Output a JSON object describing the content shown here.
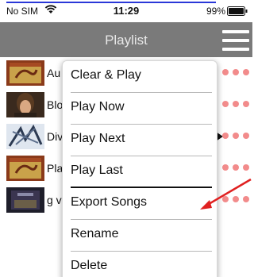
{
  "status_bar": {
    "carrier": "No SIM",
    "time": "11:29",
    "battery": "99%"
  },
  "nav": {
    "title": "Playlist"
  },
  "playlist": {
    "rows": [
      {
        "title": "Au"
      },
      {
        "title": "Blo"
      },
      {
        "title": "Div"
      },
      {
        "title": "Pla"
      },
      {
        "title": "g v"
      }
    ]
  },
  "menu": {
    "items": [
      {
        "label": "Clear & Play"
      },
      {
        "label": "Play Now"
      },
      {
        "label": "Play Next"
      },
      {
        "label": "Play Last"
      },
      {
        "label": "Export Songs"
      },
      {
        "label": "Rename"
      },
      {
        "label": "Delete"
      }
    ]
  },
  "colors": {
    "nav_bar": "#7a7a7a",
    "more_dots": "#f28b8b",
    "annotation_arrow": "#e02020",
    "top_rule": "#2a38d8"
  }
}
